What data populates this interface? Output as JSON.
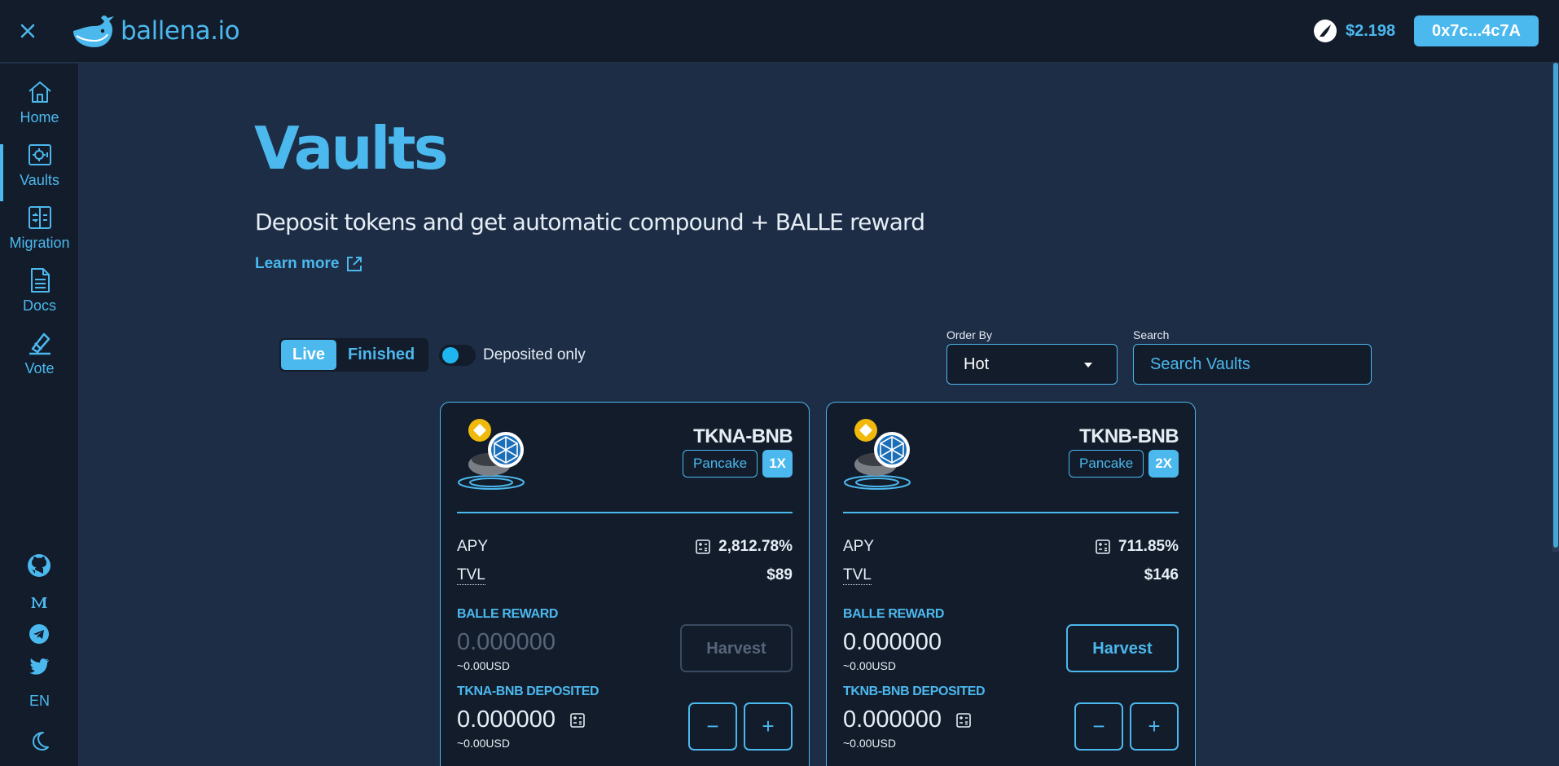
{
  "header": {
    "logo_text": "ballena.io",
    "price": "$2.198",
    "wallet": "0x7c...4c7A"
  },
  "sidebar": {
    "items": [
      {
        "label": "Home",
        "icon": "home-icon"
      },
      {
        "label": "Vaults",
        "icon": "vault-icon",
        "active": true
      },
      {
        "label": "Migration",
        "icon": "migration-icon"
      },
      {
        "label": "Docs",
        "icon": "docs-icon"
      },
      {
        "label": "Vote",
        "icon": "vote-icon"
      }
    ],
    "social": [
      "github-icon",
      "medium-icon",
      "telegram-icon",
      "twitter-icon"
    ],
    "language": "EN",
    "theme_icon": "moon-icon"
  },
  "page": {
    "title": "Vaults",
    "subtitle": "Deposit tokens and get automatic compound + BALLE reward",
    "learn_more": "Learn more"
  },
  "filters": {
    "tabs": [
      "Live",
      "Finished"
    ],
    "active_tab": "Live",
    "deposited_only_label": "Deposited only",
    "order_by_label": "Order By",
    "order_by_value": "Hot",
    "search_label": "Search",
    "search_placeholder": "Search Vaults"
  },
  "vaults": [
    {
      "pair": "TKNA-BNB",
      "platform": "Pancake",
      "multiplier": "1X",
      "apy_label": "APY",
      "apy": "2,812.78%",
      "tvl_label": "TVL",
      "tvl": "$89",
      "reward_label": "BALLE REWARD",
      "reward": "0.000000",
      "reward_usd": "~0.00USD",
      "harvest_label": "Harvest",
      "harvest_enabled": false,
      "deposited_label": "TKNA-BNB DEPOSITED",
      "deposited": "0.000000",
      "deposited_usd": "~0.00USD",
      "minus": "−",
      "plus": "+"
    },
    {
      "pair": "TKNB-BNB",
      "platform": "Pancake",
      "multiplier": "2X",
      "apy_label": "APY",
      "apy": "711.85%",
      "tvl_label": "TVL",
      "tvl": "$146",
      "reward_label": "BALLE REWARD",
      "reward": "0.000000",
      "reward_usd": "~0.00USD",
      "harvest_label": "Harvest",
      "harvest_enabled": true,
      "deposited_label": "TKNB-BNB DEPOSITED",
      "deposited": "0.000000",
      "deposited_usd": "~0.00USD",
      "minus": "−",
      "plus": "+"
    }
  ],
  "colors": {
    "accent": "#4bb8ee",
    "background": "#1d2d45",
    "panel": "#131c2a",
    "bnb_yellow": "#f0b90b"
  }
}
